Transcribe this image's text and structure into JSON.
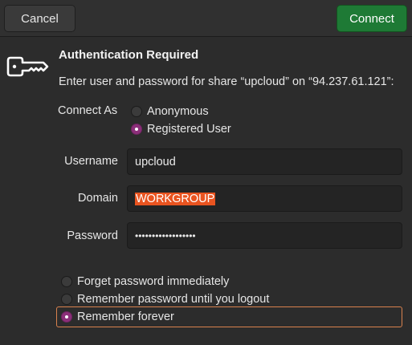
{
  "headerbar": {
    "cancel_label": "Cancel",
    "connect_label": "Connect",
    "connect_color": "#1e7a35"
  },
  "dialog": {
    "icon": "key-icon",
    "title": "Authentication Required",
    "message": "Enter user and password for share “upcloud” on “94.237.61.121”:"
  },
  "connect_as": {
    "label": "Connect As",
    "options": [
      {
        "label": "Anonymous",
        "checked": false
      },
      {
        "label": "Registered User",
        "checked": true
      }
    ]
  },
  "fields": {
    "username": {
      "label": "Username",
      "value": "upcloud"
    },
    "domain": {
      "label": "Domain",
      "value": "WORKGROUP"
    },
    "password": {
      "label": "Password",
      "value": "••••••••••••••••••"
    }
  },
  "remember": {
    "options": [
      {
        "label": "Forget password immediately",
        "checked": false
      },
      {
        "label": "Remember password until you logout",
        "checked": false
      },
      {
        "label": "Remember forever",
        "checked": true
      }
    ]
  },
  "colors": {
    "accent": "#e95420",
    "radio_checked": "#8c2f7a",
    "background": "#2c2c2c"
  }
}
